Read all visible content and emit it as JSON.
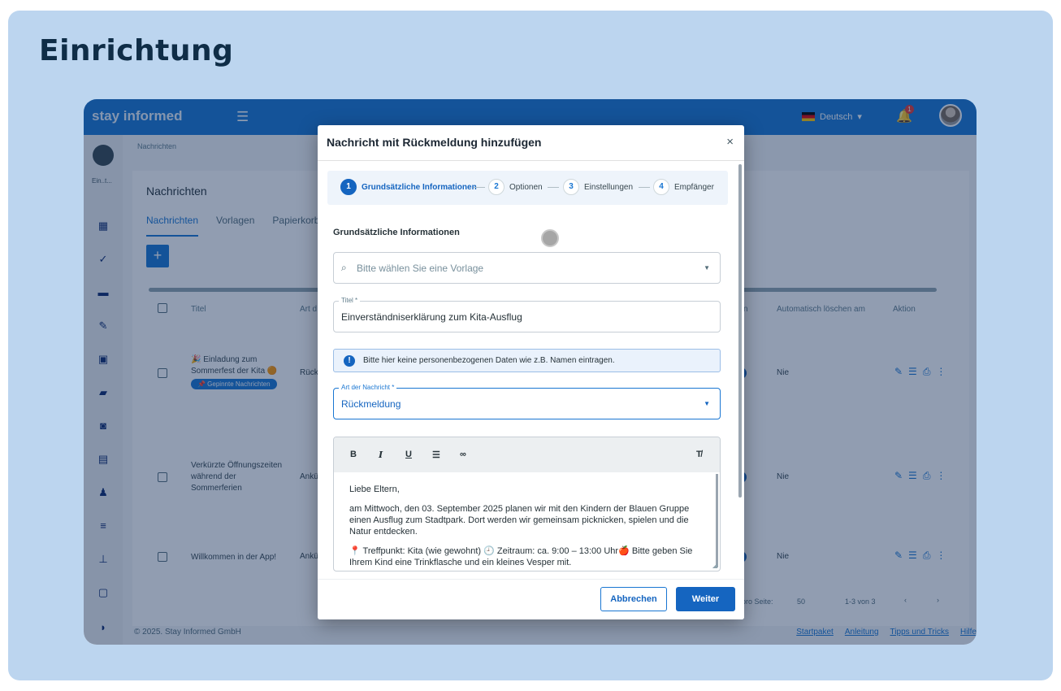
{
  "page": {
    "heading": "Einrichtung"
  },
  "app": {
    "logo": "stay informed",
    "language": "Deutsch",
    "notification_count": "1",
    "breadcrumb": "Nachrichten",
    "sidebar_user_label": "Ein..t...",
    "section_title": "Nachrichten",
    "tabs": [
      "Nachrichten",
      "Vorlagen",
      "Papierkorb"
    ],
    "add_button": "+",
    "columns": {
      "title": "Titel",
      "art": "Art d",
      "n": "n",
      "auto_delete": "Automatisch löschen am",
      "action": "Aktion"
    },
    "rows": [
      {
        "title": "🎉 Einladung zum Sommerfest der Kita 🟠",
        "art": "Rück",
        "delete": "Nie",
        "chip": "📌 Gepinnte Nachrichten"
      },
      {
        "title": "Verkürzte Öffnungszeiten während der Sommerferien",
        "art": "Ankü",
        "delete": "Nie"
      },
      {
        "title": "Willkommen in der App!",
        "art": "Ankü",
        "delete": "Nie"
      }
    ],
    "pager": {
      "per_page_label": "pro Seite:",
      "per_page": "50",
      "range": "1-3 von 3"
    },
    "footer": {
      "copyright": "© 2025. Stay Informed GmbH",
      "links": [
        "Startpaket",
        "Anleitung",
        "Tipps und Tricks",
        "Hilfe"
      ]
    }
  },
  "modal": {
    "title": "Nachricht mit Rückmeldung hinzufügen",
    "close": "×",
    "steps": [
      {
        "num": "1",
        "label": "Grundsätzliche Informationen"
      },
      {
        "num": "2",
        "label": "Optionen"
      },
      {
        "num": "3",
        "label": "Einstellungen"
      },
      {
        "num": "4",
        "label": "Empfänger"
      }
    ],
    "section_heading": "Grundsätzliche Informationen",
    "template_placeholder": "Bitte wählen Sie eine Vorlage",
    "title_label": "Titel *",
    "title_value": "Einverständniserklärung zum Kita-Ausflug",
    "info_text": "Bitte hier keine personenbezogenen Daten wie z.B. Namen eintragen.",
    "type_label": "Art der Nachricht *",
    "type_value": "Rückmeldung",
    "editor_text": {
      "p1": "Liebe Eltern,",
      "p2": "am Mittwoch, den 03. September 2025 planen wir mit den Kindern der Blauen Gruppe einen Ausflug zum Stadtpark. Dort werden wir gemeinsam picknicken, spielen und die Natur entdecken.",
      "p3": "📍 Treffpunkt: Kita (wie gewohnt) 🕘 Zeitraum: ca. 9:00 – 13:00 Uhr🍎 Bitte geben Sie Ihrem Kind eine Trinkflasche und ein kleines Vesper mit."
    },
    "cancel": "Abbrechen",
    "next": "Weiter"
  },
  "colors": {
    "accent": "#1565c0",
    "background": "#bcd5ef",
    "heading": "#0f2d47"
  }
}
